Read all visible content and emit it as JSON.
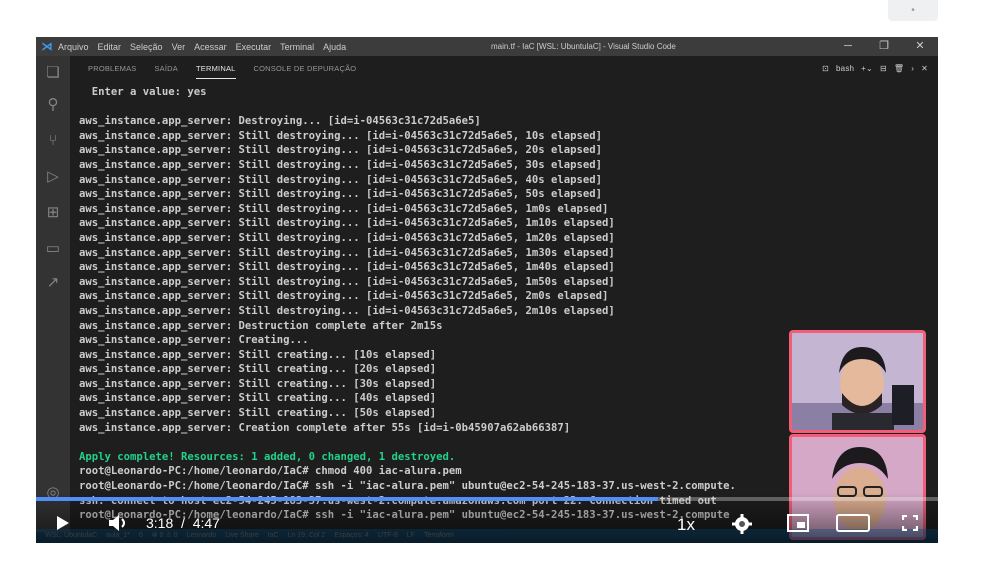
{
  "page": {
    "corner_button_icon": "dot-icon"
  },
  "window": {
    "title": "main.tf - IaC [WSL: UbuntulaC] - Visual Studio Code",
    "menu": [
      "Arquivo",
      "Editar",
      "Seleção",
      "Ver",
      "Acessar",
      "Executar",
      "Terminal",
      "Ajuda"
    ],
    "controls": [
      "minimize-icon",
      "maximize-icon",
      "close-icon"
    ]
  },
  "activity_bar": [
    "explorer-icon",
    "search-icon",
    "source-control-icon",
    "run-debug-icon",
    "extensions-icon",
    "remote-explorer-icon",
    "live-share-icon",
    "account-icon"
  ],
  "panel": {
    "tabs": [
      "PROBLEMAS",
      "SAÍDA",
      "TERMINAL",
      "CONSOLE DE DEPURAÇÃO"
    ],
    "active_tab": "TERMINAL",
    "shell": "bash"
  },
  "terminal": {
    "lines": [
      {
        "text": "  Enter a value: yes",
        "style": "normal"
      },
      {
        "text": "",
        "style": "normal"
      },
      {
        "text": "aws_instance.app_server: Destroying... [id=i-04563c31c72d5a6e5]",
        "style": "normal"
      },
      {
        "text": "aws_instance.app_server: Still destroying... [id=i-04563c31c72d5a6e5, 10s elapsed]",
        "style": "normal"
      },
      {
        "text": "aws_instance.app_server: Still destroying... [id=i-04563c31c72d5a6e5, 20s elapsed]",
        "style": "normal"
      },
      {
        "text": "aws_instance.app_server: Still destroying... [id=i-04563c31c72d5a6e5, 30s elapsed]",
        "style": "normal"
      },
      {
        "text": "aws_instance.app_server: Still destroying... [id=i-04563c31c72d5a6e5, 40s elapsed]",
        "style": "normal"
      },
      {
        "text": "aws_instance.app_server: Still destroying... [id=i-04563c31c72d5a6e5, 50s elapsed]",
        "style": "normal"
      },
      {
        "text": "aws_instance.app_server: Still destroying... [id=i-04563c31c72d5a6e5, 1m0s elapsed]",
        "style": "normal"
      },
      {
        "text": "aws_instance.app_server: Still destroying... [id=i-04563c31c72d5a6e5, 1m10s elapsed]",
        "style": "normal"
      },
      {
        "text": "aws_instance.app_server: Still destroying... [id=i-04563c31c72d5a6e5, 1m20s elapsed]",
        "style": "normal"
      },
      {
        "text": "aws_instance.app_server: Still destroying... [id=i-04563c31c72d5a6e5, 1m30s elapsed]",
        "style": "normal"
      },
      {
        "text": "aws_instance.app_server: Still destroying... [id=i-04563c31c72d5a6e5, 1m40s elapsed]",
        "style": "normal"
      },
      {
        "text": "aws_instance.app_server: Still destroying... [id=i-04563c31c72d5a6e5, 1m50s elapsed]",
        "style": "normal"
      },
      {
        "text": "aws_instance.app_server: Still destroying... [id=i-04563c31c72d5a6e5, 2m0s elapsed]",
        "style": "normal"
      },
      {
        "text": "aws_instance.app_server: Still destroying... [id=i-04563c31c72d5a6e5, 2m10s elapsed]",
        "style": "normal"
      },
      {
        "text": "aws_instance.app_server: Destruction complete after 2m15s",
        "style": "normal"
      },
      {
        "text": "aws_instance.app_server: Creating...",
        "style": "normal"
      },
      {
        "text": "aws_instance.app_server: Still creating... [10s elapsed]",
        "style": "normal"
      },
      {
        "text": "aws_instance.app_server: Still creating... [20s elapsed]",
        "style": "normal"
      },
      {
        "text": "aws_instance.app_server: Still creating... [30s elapsed]",
        "style": "normal"
      },
      {
        "text": "aws_instance.app_server: Still creating... [40s elapsed]",
        "style": "normal"
      },
      {
        "text": "aws_instance.app_server: Still creating... [50s elapsed]",
        "style": "normal"
      },
      {
        "text": "aws_instance.app_server: Creation complete after 55s [id=i-0b45907a62ab66387]",
        "style": "normal"
      },
      {
        "text": "",
        "style": "normal"
      },
      {
        "text": "Apply complete! Resources: 1 added, 0 changed, 1 destroyed.",
        "style": "green"
      },
      {
        "text": "root@Leonardo-PC:/home/leonardo/IaC# chmod 400 iac-alura.pem",
        "style": "normal"
      },
      {
        "text": "root@Leonardo-PC:/home/leonardo/IaC# ssh -i \"iac-alura.pem\" ubuntu@ec2-54-245-183-37.us-west-2.compute.",
        "style": "normal"
      },
      {
        "text": "ssh: connect to host ec2-54-245-183-37.us-west-2.compute.amazonaws.com port 22: Connection timed out",
        "style": "normal"
      },
      {
        "text": "root@Leonardo-PC:/home/leonardo/IaC# ssh -i \"iac-alura.pem\" ubuntu@ec2-54-245-183-37.us-west-2.compute",
        "style": "normal"
      }
    ]
  },
  "status_bar": [
    "WSL: UbuntulaC",
    "aula_1*",
    "0",
    "⊗ 0 ⚠ 0",
    "Leonardo",
    "Live Share",
    "IaC",
    "Ln 19, Col 2",
    "Espaços: 4",
    "UTF-8",
    "LF",
    "Terraform"
  ],
  "player": {
    "current_time": "3:18",
    "separator": "/",
    "duration": "4:47",
    "speed": "1x",
    "progress": 0.69,
    "icons": [
      "play-icon",
      "volume-icon",
      "settings-gear-icon",
      "miniplayer-icon",
      "theater-mode-icon",
      "fullscreen-icon"
    ]
  },
  "webcams": [
    {
      "name": "presenter-webcam-1",
      "border_color": "#f35d78"
    },
    {
      "name": "presenter-webcam-2",
      "border_color": "#f35d78"
    }
  ]
}
